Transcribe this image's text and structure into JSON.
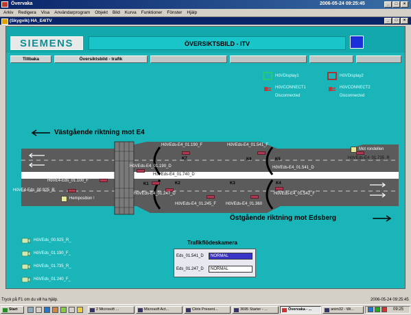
{
  "window": {
    "title": "Övervaka",
    "clock": "2006-05-24  09:25:45",
    "child_title": "(Skygvik) HA_E4ITV"
  },
  "menu": [
    "Arkiv",
    "Redigera",
    "Visa",
    "Användarprogram",
    "Objekt",
    "Bild",
    "Kurva",
    "Funktioner",
    "Fönster",
    "Hjälp"
  ],
  "header": {
    "logo": "SIEMENS",
    "title": "ÖVERSIKTSBILD - ITV"
  },
  "nav": {
    "back": "Tillbaka",
    "traffic": "Översiktsbild - trafik"
  },
  "legend": {
    "display1": "HöVDisplay1",
    "display2": "HöVDisplay2",
    "connect1": "HöVCONNECT1",
    "connect2": "HöVCONNECT2",
    "disconnected": "Disconnected"
  },
  "directions": {
    "west": "Västgående riktning mot E4",
    "east": "Östgående riktning mot Edsberg"
  },
  "cameras": {
    "c01190f": "HöVEds-E4_01.190_F",
    "c01541f": "HöVEds-E4_01.541_F",
    "c01190d": "HöVEds-E4_01.190_D",
    "c01740d": "HöVEds-E4_01.740_D",
    "c01541d": "HöVEds-E4_01.541_D",
    "c01735r": "HöVEds-E4_01.735_R",
    "c01100f": "HöVE4-Eds_01.100_F",
    "c00925r": "HöVE4-Eds_00.925_R",
    "c01247d": "HöVEds-E4_01.247_D",
    "c01542f": "HöVEds-E4_01.542_F",
    "c01245f": "HöVEds-E4_01.245_F",
    "c01360": "HöVEds-E4_01.360",
    "mot_rondellen": "Mot rondellen",
    "hemposition": "Hemposition !"
  },
  "zones": [
    "K7",
    "K6",
    "K5",
    "K1",
    "K2",
    "K3",
    "K4"
  ],
  "side_cameras": [
    "HöVEds_00.925_R_",
    "HöVEds_01.190_F_",
    "HöVEds_01.735_R_",
    "HöVEds_01.240_F_"
  ],
  "panel": {
    "title": "Trafikflödeskamera",
    "row1_label": "Eds_01.541_D",
    "row1_value": "NORMAL",
    "row2_label": "Eds_01.247_D",
    "row2_value": "NORMAL"
  },
  "status": {
    "text": "Tryck på F1 om du vill ha hjälp.",
    "date": "2006-05-24  09:25:45"
  },
  "taskbar": {
    "start": "Start",
    "items": [
      "2 Microsoft ...",
      "Microsoft Act...",
      "Citrix Present...",
      "3695 Starter - ...",
      "Övervaka - ...",
      "anim32 - Wi..."
    ],
    "time": "09:25"
  },
  "colors": {
    "canvas": "#1ab5b8",
    "road": "#5b5b5b",
    "highlight": "#3a35c8"
  }
}
